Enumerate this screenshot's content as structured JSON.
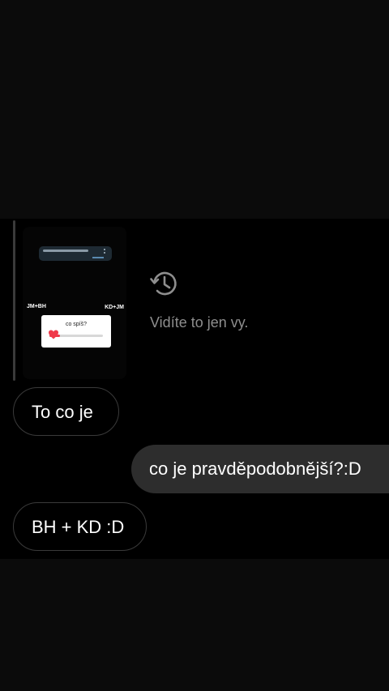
{
  "story_reply": {
    "thumbnail": {
      "label_left": "JM+BH",
      "label_right": "KD+JM",
      "poll_question": "co spíš?",
      "poll_fraction": 0.2
    }
  },
  "notice": {
    "icon": "history-icon",
    "text": "Vidíte to jen vy."
  },
  "messages": [
    {
      "direction": "received",
      "text": "To co je"
    },
    {
      "direction": "sent",
      "text": "co je pravděpodobnější?:D"
    },
    {
      "direction": "received",
      "text": "BH + KD :D"
    }
  ],
  "colors": {
    "background": "#000000",
    "sent_bubble": "#2d2d2d",
    "received_border": "#3a3a3a",
    "muted_text": "#8e8e8e",
    "poll_accent": "#ef3a4a"
  }
}
